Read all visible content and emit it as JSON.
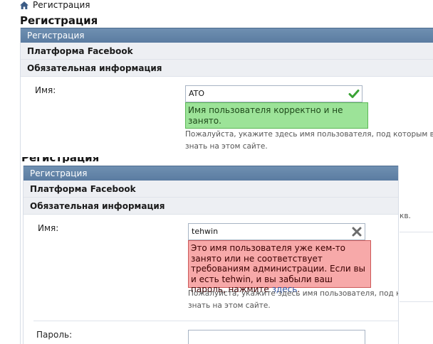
{
  "breadcrumb": {
    "label": "Регистрация"
  },
  "page_title": "Регистрация",
  "back_form": {
    "bar_title": "Регистрация",
    "section_platform": "Платформа Facebook",
    "section_required": "Обязательная информация",
    "name_label": "Имя:",
    "name_value": "ATO",
    "success_message": "Имя пользователя корректно и не занято.",
    "hint_line1": "Пожалуйста, укажите здесь имя пользователя, под которым вы буд",
    "hint_line2": "знать на этом сайте.",
    "peek_text": "кв.",
    "peek_title": "Регистрация"
  },
  "front_form": {
    "bar_title": "Регистрация",
    "section_platform": "Платформа Facebook",
    "section_required": "Обязательная информация",
    "name_label": "Имя:",
    "name_value": "tehwin",
    "error_message_prefix": "Это имя пользователя уже кем-то занято или не соответствует требованиям администрации. Если вы и есть tehwin, и вы забыли ваш пароль, нажмите",
    "error_link": "здесь",
    "error_suffix": ".",
    "hint_line1": "Пожалуйста, укажите здесь имя пользователя, под котор",
    "hint_line2": "знать на этом сайте.",
    "password_label": "Пароль:",
    "password_value": ""
  },
  "colors": {
    "bar": "#5f80a6",
    "success_bg": "#9ce398",
    "error_bg": "#f7a9a9",
    "link": "#2b4f9e"
  },
  "icons": [
    "home-icon",
    "checkmark-icon",
    "clear-x-icon"
  ]
}
